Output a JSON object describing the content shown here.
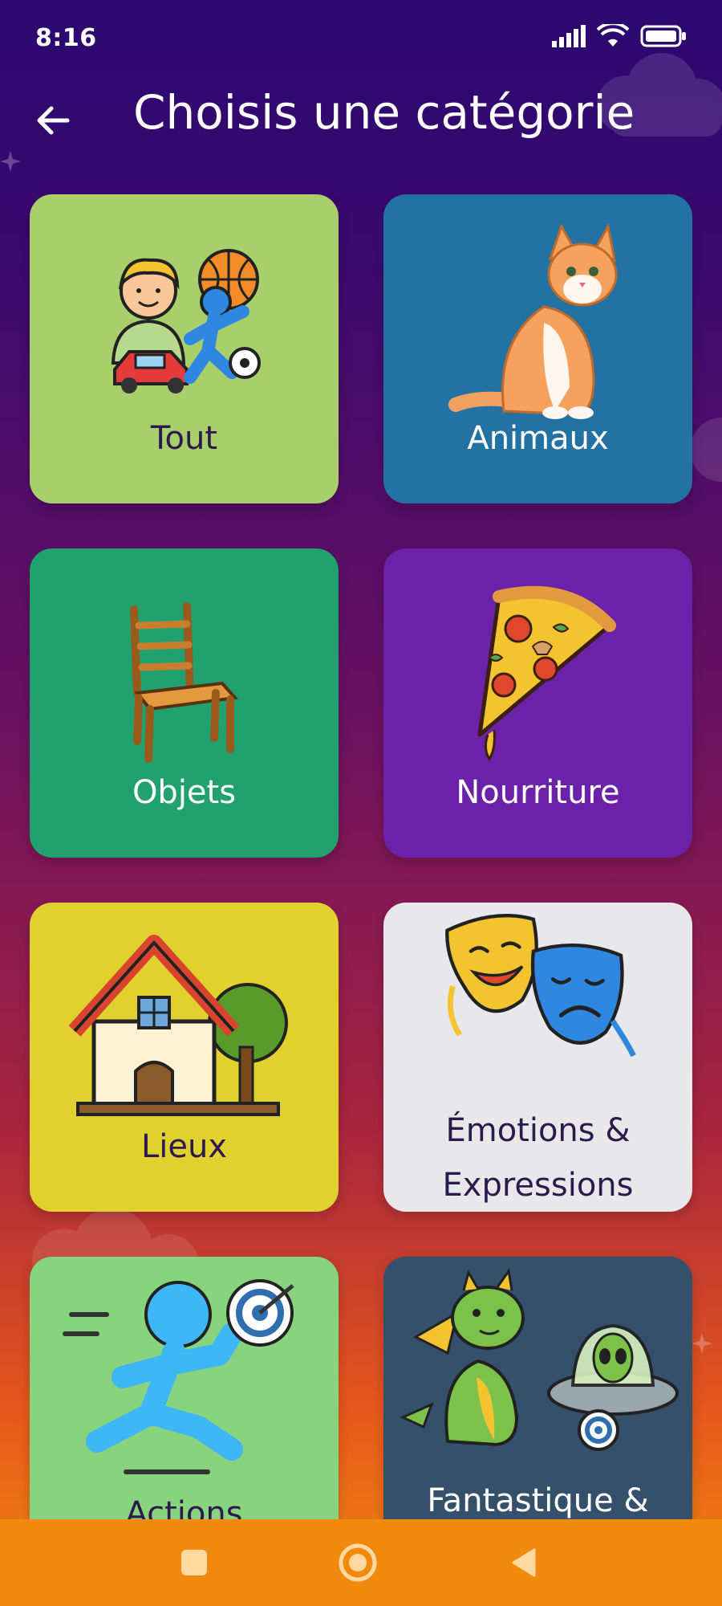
{
  "status_bar": {
    "time": "8:16",
    "icons": [
      "signal-icon",
      "wifi-icon",
      "battery-icon"
    ]
  },
  "header": {
    "title": "Choisis une catégorie",
    "back_icon": "arrow-left-icon"
  },
  "categories": [
    {
      "label": "Tout",
      "bg": "#a8cf6c",
      "text_color": "#2c1a4d",
      "icon": "kids-playing-icon"
    },
    {
      "label": "Animaux",
      "bg": "#2471a3",
      "text_color": "#ffffff",
      "icon": "cat-icon"
    },
    {
      "label": "Objets",
      "bg": "#21a16f",
      "text_color": "#ffffff",
      "icon": "chair-icon"
    },
    {
      "label": "Nourriture",
      "bg": "#6b21a8",
      "text_color": "#ffffff",
      "icon": "pizza-icon"
    },
    {
      "label": "Lieux",
      "bg": "#e0d12f",
      "text_color": "#2c1a4d",
      "icon": "house-icon"
    },
    {
      "label_line1": "Émotions &",
      "label_line2": "Expressions",
      "bg": "#e8e8ea",
      "text_color": "#2c1a4d",
      "icon": "theater-masks-icon"
    },
    {
      "label": "Actions",
      "bg": "#88d37e",
      "text_color": "#2c1a4d",
      "icon": "running-person-icon"
    },
    {
      "label": "Fantastique &",
      "bg": "#34506a",
      "text_color": "#ffffff",
      "icon": "dragon-alien-icon"
    }
  ],
  "nav_bar": {
    "buttons": [
      "square-icon",
      "home-circle-icon",
      "back-triangle-icon"
    ]
  }
}
